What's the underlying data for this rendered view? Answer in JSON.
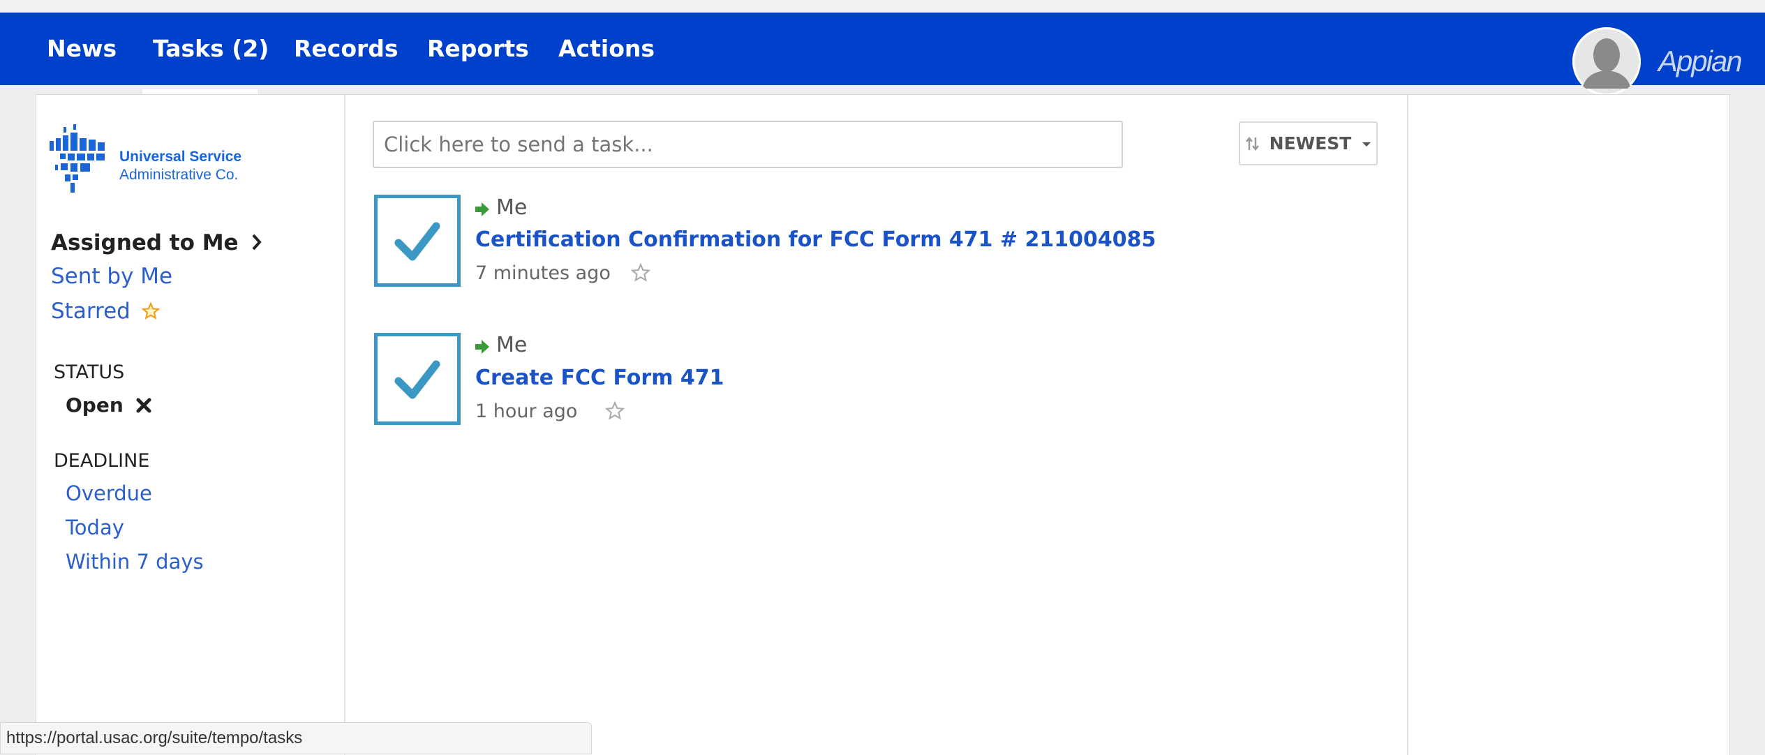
{
  "nav": {
    "tabs": [
      {
        "label": "News"
      },
      {
        "label": "Tasks (2)",
        "active": true
      },
      {
        "label": "Records"
      },
      {
        "label": "Reports"
      },
      {
        "label": "Actions"
      }
    ],
    "brand": "Appian",
    "color": "#0041cb"
  },
  "logo": {
    "line1": "Universal Service",
    "line2": "Administrative Co."
  },
  "sidebar": {
    "filters": [
      {
        "label": "Assigned to Me",
        "active": true
      },
      {
        "label": "Sent by Me"
      },
      {
        "label": "Starred"
      }
    ],
    "status_heading": "STATUS",
    "status_value": "Open",
    "deadline_heading": "DEADLINE",
    "deadline_options": [
      "Overdue",
      "Today",
      "Within 7 days"
    ]
  },
  "search": {
    "placeholder": "Click here to send a task..."
  },
  "sort": {
    "label": "NEWEST"
  },
  "tasks": [
    {
      "assignee": "Me",
      "title": "Certification Confirmation for FCC Form 471 # 211004085",
      "time": "7 minutes ago"
    },
    {
      "assignee": "Me",
      "title": "Create FCC Form 471",
      "time": "1 hour ago"
    }
  ],
  "status_url": "https://portal.usac.org/suite/tempo/tasks"
}
